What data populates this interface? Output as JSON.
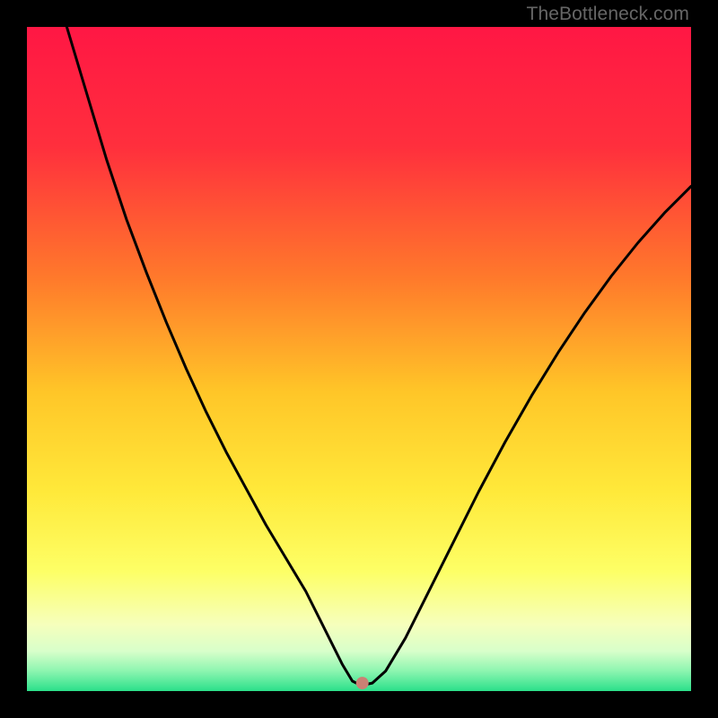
{
  "watermark": "TheBottleneck.com",
  "marker": {
    "x_pct": 50.5,
    "y_pct": 98.8,
    "r": 7,
    "color": "#cb8074"
  },
  "colors": {
    "curve": "#000000",
    "marker": "#cb8074",
    "gradient_stops": [
      {
        "offset": 0,
        "color": "#ff1744"
      },
      {
        "offset": 18,
        "color": "#ff2f3d"
      },
      {
        "offset": 38,
        "color": "#ff7a2b"
      },
      {
        "offset": 55,
        "color": "#ffc628"
      },
      {
        "offset": 70,
        "color": "#ffe93a"
      },
      {
        "offset": 82,
        "color": "#fdff66"
      },
      {
        "offset": 90,
        "color": "#f6ffbc"
      },
      {
        "offset": 94,
        "color": "#d8ffca"
      },
      {
        "offset": 97,
        "color": "#8cf5b0"
      },
      {
        "offset": 100,
        "color": "#2be08a"
      }
    ],
    "background": "#000000"
  },
  "chart_data": {
    "type": "line",
    "title": "",
    "xlabel": "",
    "ylabel": "",
    "xlim_pct": [
      0,
      100
    ],
    "ylim_pct": [
      0,
      100
    ],
    "series": [
      {
        "name": "bottleneck-curve",
        "x_pct": [
          6,
          9,
          12,
          15,
          18,
          21,
          24,
          27,
          30,
          33,
          36,
          39,
          42,
          44,
          46,
          47.5,
          49,
          50,
          51,
          52,
          54,
          57,
          60,
          64,
          68,
          72,
          76,
          80,
          84,
          88,
          92,
          96,
          100
        ],
        "y_pct": [
          100,
          90,
          80,
          71,
          63,
          55.5,
          48.5,
          42,
          36,
          30.5,
          25,
          20,
          15,
          11,
          7,
          4,
          1.5,
          1,
          1,
          1.2,
          3,
          8,
          14,
          22,
          30,
          37.5,
          44.5,
          51,
          57,
          62.5,
          67.5,
          72,
          76
        ]
      }
    ],
    "marker_point": {
      "x_pct": 50.5,
      "y_pct": 1.2
    },
    "legend": false,
    "grid": false
  }
}
